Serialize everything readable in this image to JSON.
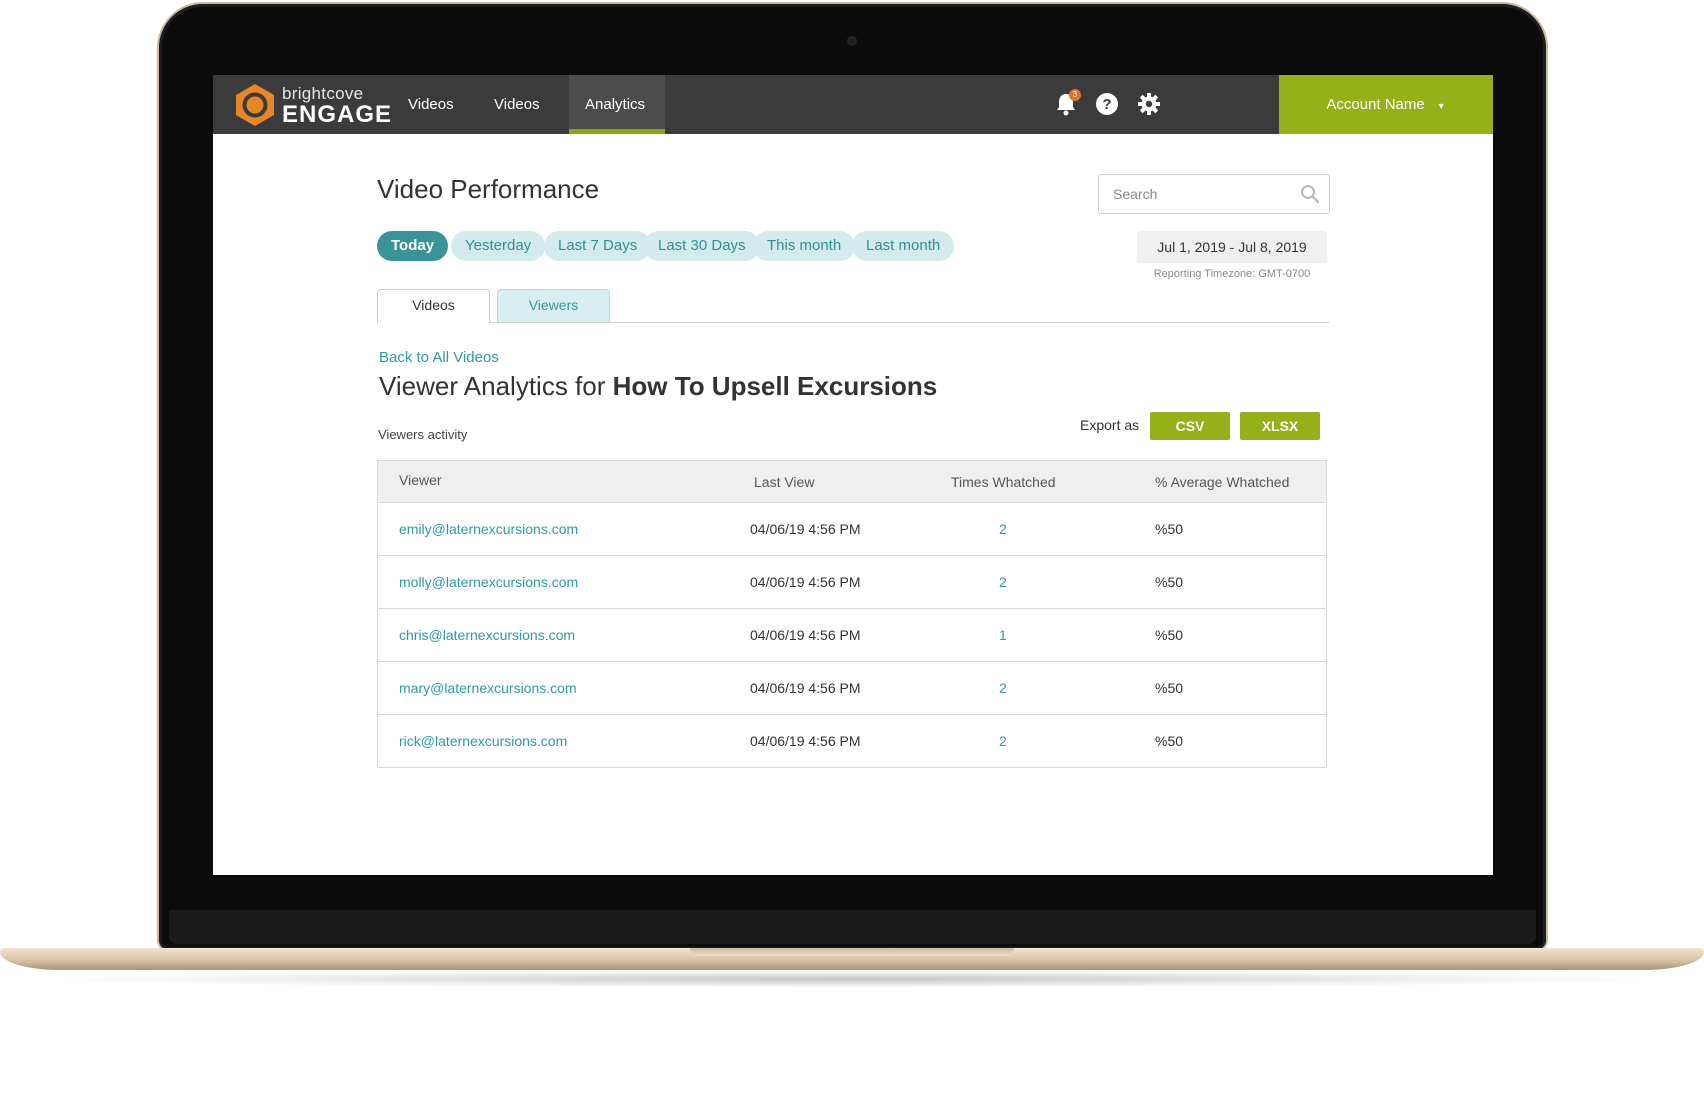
{
  "brand": {
    "top": "brightcove",
    "bottom": "ENGAGE",
    "accent_color": "#e8862a"
  },
  "nav": {
    "items": [
      {
        "label": "Videos",
        "active": false
      },
      {
        "label": "Videos",
        "active": false
      },
      {
        "label": "Analytics",
        "active": true
      }
    ],
    "notification_count": "3",
    "icons": [
      "bell-icon",
      "help-icon",
      "gear-icon"
    ],
    "account": {
      "label": "Account Name",
      "caret": "▼"
    }
  },
  "page": {
    "title": "Video Performance",
    "search_placeholder": "Search",
    "date_filters": [
      "Today",
      "Yesterday",
      "Last 7 Days",
      "Last 30 Days",
      "This month",
      "Last month"
    ],
    "active_filter": "Today",
    "date_range": "Jul 1, 2019 - Jul 8, 2019",
    "timezone": "Reporting Timezone: GMT-0700"
  },
  "tabs": [
    {
      "label": "Videos",
      "active": true
    },
    {
      "label": "Viewers",
      "active": false
    }
  ],
  "viewer_section": {
    "back_link": "Back to All Videos",
    "heading_prefix": "Viewer Analytics for",
    "heading_video": "How To Upsell Excursions",
    "activity_label": "Viewers activity",
    "export_label": "Export as",
    "export_buttons": [
      "CSV",
      "XLSX"
    ]
  },
  "table": {
    "headers": [
      "Viewer",
      "Last View",
      "Times Whatched",
      "% Average Whatched"
    ],
    "rows": [
      {
        "viewer": "emily@laternexcursions.com",
        "last_view": "04/06/19 4:56 PM",
        "times": "2",
        "avg": "%50"
      },
      {
        "viewer": "molly@laternexcursions.com",
        "last_view": "04/06/19 4:56 PM",
        "times": "2",
        "avg": "%50"
      },
      {
        "viewer": "chris@laternexcursions.com",
        "last_view": "04/06/19 4:56 PM",
        "times": "1",
        "avg": "%50"
      },
      {
        "viewer": "mary@laternexcursions.com",
        "last_view": "04/06/19 4:56 PM",
        "times": "2",
        "avg": "%50"
      },
      {
        "viewer": "rick@laternexcursions.com",
        "last_view": "04/06/19 4:56 PM",
        "times": "2",
        "avg": "%50"
      }
    ]
  },
  "colors": {
    "nav_bg": "#3b3b3b",
    "green": "#96b01a",
    "teal": "#3a9399",
    "teal_light": "#d4ebed",
    "link": "#2f9aa3"
  }
}
